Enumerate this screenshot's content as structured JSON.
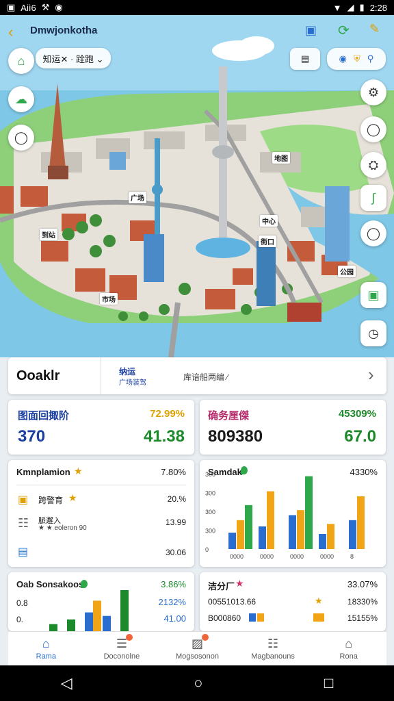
{
  "status_bar": {
    "left_icons": [
      "▣",
      "⚒",
      "⚘",
      "◉"
    ],
    "left_text": "Aiì6",
    "time": "2:28",
    "wifi": "▼",
    "signal": "◢",
    "battery": "▮"
  },
  "header": {
    "title": "Dmwjonkotha",
    "back": "‹"
  },
  "top_chip": "知运✕ · 跧跑 ⌄",
  "map_labels": [
    "地图",
    "广场",
    "到站",
    "街口",
    "中心",
    "公园",
    "市场"
  ],
  "search": {
    "title": "Ooaklr",
    "sub_title": "纳运",
    "sub_caption": "广场装驾",
    "hint": "库谙船两编 ∕",
    "chevron": "›"
  },
  "stats": [
    {
      "label": "图面回掫阶",
      "label_color": "#1a3fa0",
      "pct": "72.99%",
      "pct_color": "#e0a000",
      "left_value": "370",
      "left_color": "#1a3fa0",
      "right_value": "41.38",
      "right_color": "#1c8a2a"
    },
    {
      "label": "确务厘傑",
      "label_color": "#b52a6a",
      "pct": "45309%",
      "pct_color": "#1c8a2a",
      "left_value": "809380",
      "left_color": "#1a1a1a",
      "right_value": "67.0",
      "right_color": "#1c8a2a"
    }
  ],
  "panel_a": {
    "title": "Kmnplamion",
    "title_pct": "7.80%",
    "rows": [
      {
        "icon": "▣",
        "icon_color": "#e0a000",
        "text": "跨警育",
        "value": "20.%"
      },
      {
        "icon": "☷",
        "icon_color": "#666",
        "text": "脈邂入",
        "sub": "★ ★ eoleron 90",
        "value": "13.99"
      },
      {
        "icon": "▤",
        "icon_color": "#2a7ad0",
        "text": "",
        "value": "30.06"
      }
    ]
  },
  "panel_b": {
    "title": "Samdak",
    "title_pct": "4330%",
    "chart_data": {
      "type": "bar",
      "categories": [
        "",
        "",
        "",
        "",
        ""
      ],
      "y_ticks": [
        "300",
        "300",
        "300",
        "300",
        "0"
      ],
      "x_ticks": [
        "0000",
        "0000",
        "0000",
        "0000",
        "8"
      ],
      "series": [
        {
          "color": "#2a6dd0",
          "values": [
            65,
            90,
            135,
            60,
            115
          ]
        },
        {
          "color": "#f0a416",
          "values": [
            115,
            230,
            155,
            100,
            210
          ]
        },
        {
          "color": "#2ea84a",
          "values": [
            175,
            0,
            290,
            0,
            0
          ]
        }
      ]
    }
  },
  "panel_c": {
    "title": "Oab Sonsakoos",
    "title_pct": "3.86%",
    "labels": [
      "0.8",
      "0."
    ],
    "values": [
      "2132%",
      "41.00"
    ],
    "chart_data": {
      "type": "bar",
      "series": [
        {
          "color": "#1c8a2a",
          "values": [
            12,
            20,
            0,
            0,
            70
          ]
        },
        {
          "color": "#2a6dd0",
          "values": [
            0,
            0,
            32,
            26,
            0
          ]
        },
        {
          "color": "#f0a416",
          "values": [
            0,
            0,
            52,
            0,
            0
          ]
        }
      ]
    }
  },
  "panel_d": {
    "title": "洁分厂",
    "title_pct": "33.07%",
    "rows": [
      {
        "text": "00551013.66",
        "value": "18330%"
      },
      {
        "text": "B000860",
        "value": "15155%"
      }
    ]
  },
  "nav": [
    {
      "label": "Rama",
      "icon": "⌂",
      "active": true
    },
    {
      "label": "Doconolne",
      "icon": "☰"
    },
    {
      "label": "Mogsosonon",
      "icon": "▨"
    },
    {
      "label": "Magbanouns",
      "icon": "☷"
    },
    {
      "label": "Rona",
      "icon": "⌂"
    }
  ],
  "sysnav": {
    "back": "◁",
    "home": "○",
    "recent": "□"
  },
  "accent": "#2a6dd0"
}
